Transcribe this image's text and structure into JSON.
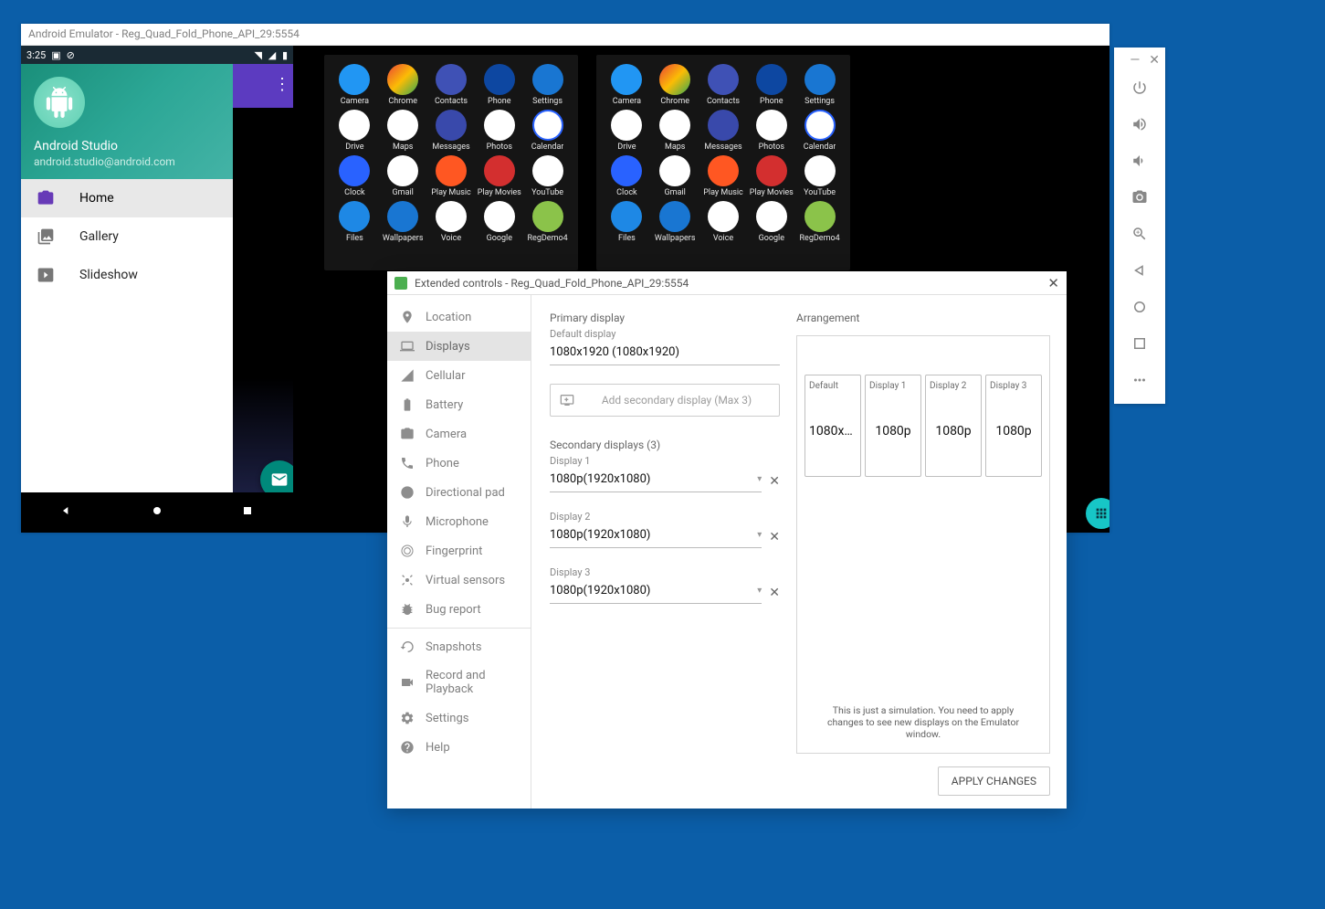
{
  "emulator": {
    "title": "Android Emulator - Reg_Quad_Fold_Phone_API_29:5554"
  },
  "phone_left": {
    "status_time": "3:25",
    "user_name": "Android Studio",
    "user_email": "android.studio@android.com",
    "menu": [
      {
        "icon": "camera",
        "label": "Home",
        "selected": true
      },
      {
        "icon": "gallery",
        "label": "Gallery",
        "selected": false
      },
      {
        "icon": "slideshow",
        "label": "Slideshow",
        "selected": false
      }
    ]
  },
  "app_drawer": {
    "rows": [
      [
        "Camera",
        "Chrome",
        "Contacts",
        "Phone",
        "Settings"
      ],
      [
        "Drive",
        "Maps",
        "Messages",
        "Photos",
        "Calendar"
      ],
      [
        "Clock",
        "Gmail",
        "Play Music",
        "Play Movies",
        "YouTube"
      ],
      [
        "Files",
        "Wallpapers",
        "Voice",
        "Google",
        "RegDemo4"
      ]
    ],
    "icon_classes": [
      [
        "ic-camera",
        "ic-chrome",
        "ic-contacts",
        "ic-phone",
        "ic-settings"
      ],
      [
        "ic-drive",
        "ic-maps",
        "ic-messages",
        "ic-photos",
        "ic-calendar"
      ],
      [
        "ic-clock",
        "ic-gmail",
        "ic-playmusic",
        "ic-playmovies",
        "ic-youtube"
      ],
      [
        "ic-files",
        "ic-wallpapers",
        "ic-voice",
        "ic-google",
        "ic-regdemo"
      ]
    ]
  },
  "side_toolbar": [
    "power",
    "volume-up",
    "volume-down",
    "screenshot",
    "zoom",
    "back",
    "home",
    "recent",
    "more"
  ],
  "ext": {
    "title": "Extended controls - Reg_Quad_Fold_Phone_API_29:5554",
    "nav": [
      {
        "icon": "pin",
        "label": "Location"
      },
      {
        "icon": "display",
        "label": "Displays",
        "active": true
      },
      {
        "icon": "cellular",
        "label": "Cellular"
      },
      {
        "icon": "battery",
        "label": "Battery"
      },
      {
        "icon": "camera",
        "label": "Camera"
      },
      {
        "icon": "phone",
        "label": "Phone"
      },
      {
        "icon": "dpad",
        "label": "Directional pad"
      },
      {
        "icon": "mic",
        "label": "Microphone"
      },
      {
        "icon": "fingerprint",
        "label": "Fingerprint"
      },
      {
        "icon": "sensors",
        "label": "Virtual sensors"
      },
      {
        "icon": "bug",
        "label": "Bug report"
      },
      {
        "icon": "snapshot",
        "label": "Snapshots",
        "divider_before": true
      },
      {
        "icon": "record",
        "label": "Record and Playback"
      },
      {
        "icon": "settings",
        "label": "Settings"
      },
      {
        "icon": "help",
        "label": "Help"
      }
    ],
    "primary": {
      "section": "Primary display",
      "label": "Default display",
      "value": "1080x1920 (1080x1920)"
    },
    "add_secondary_label": "Add secondary display (Max 3)",
    "secondary": {
      "section": "Secondary displays (3)",
      "items": [
        {
          "label": "Display 1",
          "value": "1080p(1920x1080)"
        },
        {
          "label": "Display 2",
          "value": "1080p(1920x1080)"
        },
        {
          "label": "Display 3",
          "value": "1080p(1920x1080)"
        }
      ]
    },
    "arrangement": {
      "section": "Arrangement",
      "cards": [
        {
          "title": "Default",
          "res": "1080x1…"
        },
        {
          "title": "Display 1",
          "res": "1080p"
        },
        {
          "title": "Display 2",
          "res": "1080p"
        },
        {
          "title": "Display 3",
          "res": "1080p"
        }
      ],
      "hint": "This is just a simulation. You need to apply changes to see new displays on the Emulator window."
    },
    "apply_label": "APPLY CHANGES"
  }
}
